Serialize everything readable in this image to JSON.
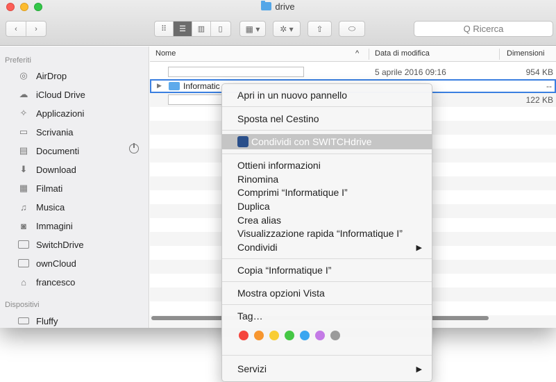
{
  "window": {
    "title": "drive"
  },
  "toolbar": {
    "back": "‹",
    "forward": "›",
    "search_placeholder": "Q Ricerca"
  },
  "sidebar": {
    "favorites_title": "Preferiti",
    "items": [
      {
        "label": "AirDrop",
        "icon": "airdrop-icon",
        "glyph": "◎"
      },
      {
        "label": "iCloud Drive",
        "icon": "cloud-icon",
        "glyph": "☁"
      },
      {
        "label": "Applicazioni",
        "icon": "applications-icon",
        "glyph": "✧"
      },
      {
        "label": "Scrivania",
        "icon": "desktop-icon",
        "glyph": "▭"
      },
      {
        "label": "Documenti",
        "icon": "documents-icon",
        "glyph": "▤"
      },
      {
        "label": "Download",
        "icon": "download-icon",
        "glyph": "⬇"
      },
      {
        "label": "Filmati",
        "icon": "movies-icon",
        "glyph": "▦"
      },
      {
        "label": "Musica",
        "icon": "music-icon",
        "glyph": "♫"
      },
      {
        "label": "Immagini",
        "icon": "pictures-icon",
        "glyph": "◙"
      },
      {
        "label": "SwitchDrive",
        "icon": "folder-icon",
        "glyph": ""
      },
      {
        "label": "ownCloud",
        "icon": "folder-icon",
        "glyph": ""
      },
      {
        "label": "francesco",
        "icon": "home-icon",
        "glyph": "⌂"
      }
    ],
    "devices_title": "Dispositivi",
    "devices": [
      {
        "label": "Fluffy",
        "icon": "disk-icon"
      }
    ]
  },
  "columns": {
    "name": "Nome",
    "sort_indicator": "^",
    "date": "Data di modifica",
    "size": "Dimensioni"
  },
  "files": [
    {
      "name": "",
      "date": "5 aprile 2016 09:16",
      "size": "954 KB"
    },
    {
      "name": "Informatic",
      "date": "",
      "size": "--"
    },
    {
      "name": "",
      "date": "",
      "size": "122 KB"
    }
  ],
  "context_menu": {
    "open_new_panel": "Apri in un nuovo pannello",
    "move_to_trash": "Sposta nel Cestino",
    "share_switchdrive": "Condividi con SWITCHdrive",
    "get_info": "Ottieni informazioni",
    "rename": "Rinomina",
    "compress": "Comprimi “Informatique I”",
    "duplicate": "Duplica",
    "make_alias": "Crea alias",
    "quick_look": "Visualizzazione rapida “Informatique I”",
    "share": "Condividi",
    "copy": "Copia “Informatique I”",
    "show_view_options": "Mostra opzioni Vista",
    "tags": "Tag…",
    "services": "Servizi",
    "submenu_arrow": "▶",
    "tag_colors": [
      "#f5453d",
      "#f7962f",
      "#f9cd33",
      "#45c744",
      "#3aa6f0",
      "#c47ae6",
      "#9b9b9b"
    ]
  }
}
